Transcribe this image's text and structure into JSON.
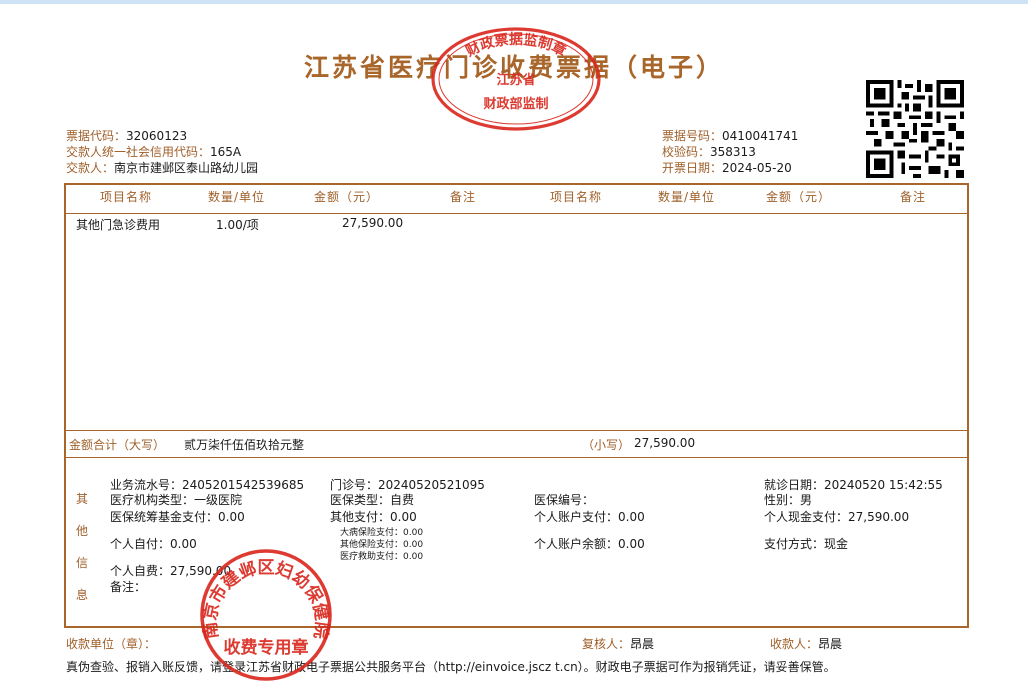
{
  "title": "江苏省医疗门诊收费票据（电子）",
  "header_left": {
    "code_label": "票据代码：",
    "code": "32060123",
    "credit_label": "交款人统一社会信用代码：",
    "credit": "165A",
    "payer_label": "交款人：",
    "payer": "南京市建邺区泰山路幼儿园"
  },
  "header_right": {
    "number_label": "票据号码：",
    "number": "0410041741",
    "check_label": "校验码：",
    "check": "358313",
    "date_label": "开票日期：",
    "date": "2024-05-20"
  },
  "columns": [
    "项目名称",
    "数量/单位",
    "金额（元）",
    "备注",
    "项目名称",
    "数量/单位",
    "金额（元）",
    "备注"
  ],
  "items": [
    {
      "name": "其他门急诊费用",
      "qty": "1.00/项",
      "amount": "27,590.00",
      "note": ""
    }
  ],
  "total": {
    "upper_label": "金额合计（大写）",
    "upper": "贰万柒仟伍佰玖拾元整",
    "lower_label": "（小写）",
    "lower": "27,590.00"
  },
  "other_info": {
    "label_chars": [
      "其",
      "他",
      "信",
      "息"
    ],
    "serial": "业务流水号：2405201542539685",
    "clinic_no": "门诊号：20240520521095",
    "visit_date": "就诊日期：20240520 15:42:55",
    "inst_type": "医疗机构类型：一级医院",
    "ins_type": "医保类型：自费",
    "ins_no": "医保编号：",
    "gender": "性别：男",
    "pool_fund": "医保统筹基金支付：0.00",
    "other_pay": "其他支付：0.00",
    "acct_pay": "个人账户支付：0.00",
    "cash_pay": "个人现金支付：27,590.00",
    "major_ins": "大病保险支付：0.00",
    "other_ins": "其他保险支付：0.00",
    "aid": "医疗救助支付：0.00",
    "self_pay": "个人自付：0.00",
    "acct_balance": "个人账户余额：0.00",
    "pay_method": "支付方式：现金",
    "self_expense": "个人自费：27,590.00",
    "remark": "备注："
  },
  "footer": {
    "unit_label": "收款单位（章）：",
    "reviewer_label": "复核人：",
    "reviewer": "昂晨",
    "payee_label": "收款人：",
    "payee": "昂晨",
    "notice": "真伪查验、报销入账反馈，请登录江苏省财政电子票据公共服务平台（http://einvoice.jscz t.cn）。财政电子票据可作为报销凭证，请妥善保管。"
  },
  "stamps": {
    "top_ring": "财政票据监制章",
    "top_mid": "江苏省",
    "top_bottom": "财政部监制",
    "bottom_ring": "南京市建邺区妇幼保健院",
    "bottom_center": "收费专用章"
  },
  "colors": {
    "accent": "#a8662a",
    "stamp": "#d9261c"
  }
}
